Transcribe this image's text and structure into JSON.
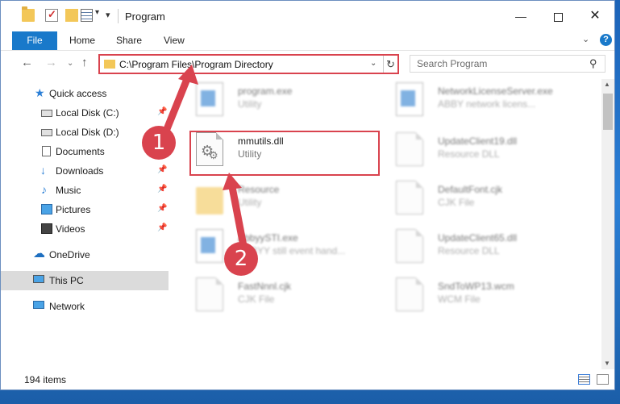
{
  "window": {
    "title": "Program"
  },
  "titlebar": {
    "minimize": "—",
    "close": "✕",
    "qa_dropdown": "▾",
    "qa_customize": "▾"
  },
  "ribbon": {
    "tabs": [
      {
        "label": "File"
      },
      {
        "label": "Home"
      },
      {
        "label": "Share"
      },
      {
        "label": "View"
      }
    ],
    "expand": "⌄",
    "help": "?"
  },
  "nav": {
    "back": "←",
    "forward": "→",
    "recent": "⌄",
    "up": "↑",
    "address": "C:\\Program Files\\Program Directory",
    "address_dropdown": "⌄",
    "refresh": "↻",
    "search_placeholder": "Search Program",
    "search_icon": "⚲"
  },
  "sidebar": {
    "items": [
      {
        "label": "Quick access",
        "icon": "star-icon"
      },
      {
        "label": "Local Disk (C:)",
        "icon": "disk-icon"
      },
      {
        "label": "Local Disk (D:)",
        "icon": "disk-icon"
      },
      {
        "label": "Documents",
        "icon": "document-icon"
      },
      {
        "label": "Downloads",
        "icon": "download-icon"
      },
      {
        "label": "Music",
        "icon": "music-icon"
      },
      {
        "label": "Pictures",
        "icon": "pictures-icon"
      },
      {
        "label": "Videos",
        "icon": "videos-icon"
      },
      {
        "label": "OneDrive",
        "icon": "cloud-icon"
      },
      {
        "label": "This PC",
        "icon": "computer-icon"
      },
      {
        "label": "Network",
        "icon": "network-icon"
      }
    ],
    "pin_glyph": "📌"
  },
  "files": [
    {
      "name": "program.exe",
      "type": "Utility"
    },
    {
      "name": "NetworkLicenseServer.exe",
      "type": "ABBY network licens..."
    },
    {
      "name": "mmutils.dll",
      "type": "Utility"
    },
    {
      "name": "UpdateClient19.dll",
      "type": "Resource DLL"
    },
    {
      "name": "Resource",
      "type": "Utility"
    },
    {
      "name": "DefaultFont.cjk",
      "type": "CJK File"
    },
    {
      "name": "AbbyySTI.exe",
      "type": "ABBYY still event hand..."
    },
    {
      "name": "UpdateClient65.dll",
      "type": "Resource DLL"
    },
    {
      "name": "FastNnnl.cjk",
      "type": "CJK File"
    },
    {
      "name": "SndToWP13.wcm",
      "type": "WCM File"
    }
  ],
  "status": {
    "count": "194 items"
  },
  "callouts": {
    "one": "1",
    "two": "2"
  },
  "colors": {
    "accent": "#1979ca",
    "highlight": "#d9434e"
  }
}
